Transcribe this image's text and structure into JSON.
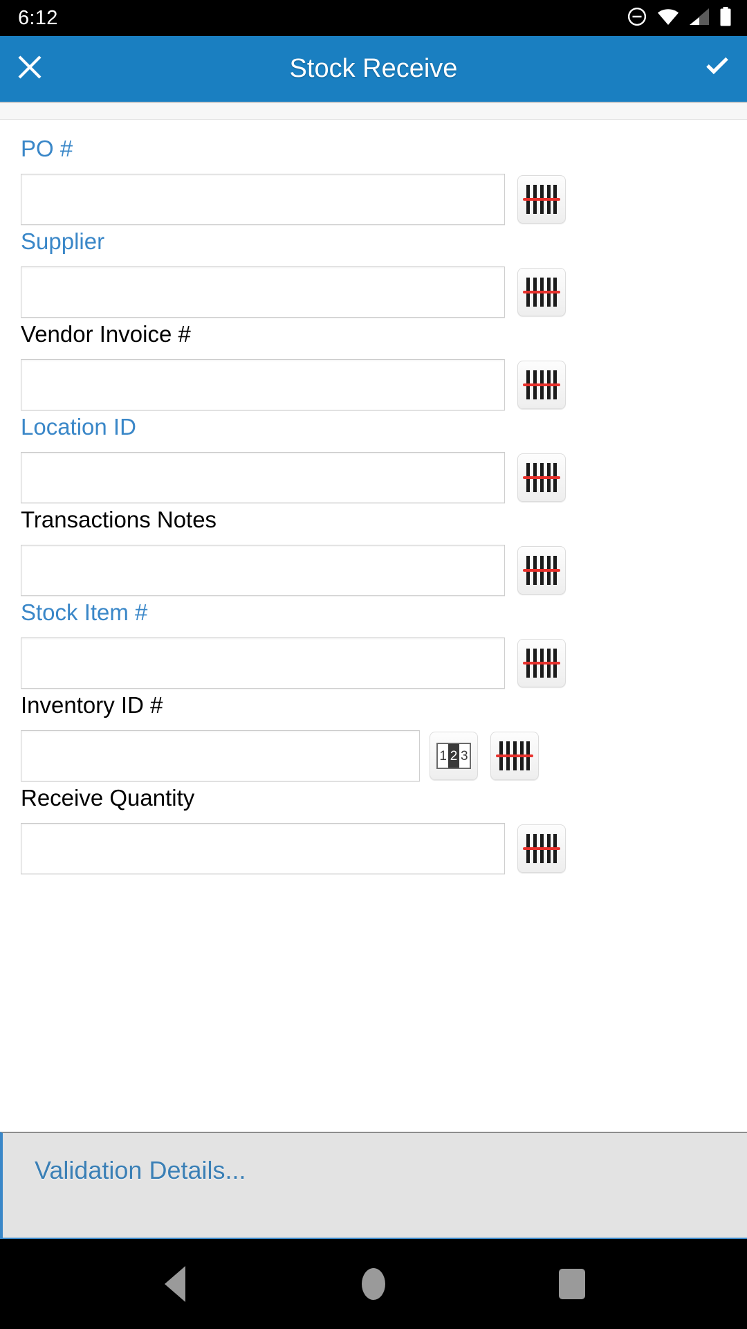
{
  "statusbar": {
    "time": "6:12",
    "icons": [
      {
        "name": "do-not-disturb-icon"
      },
      {
        "name": "wifi-icon"
      },
      {
        "name": "cellular-signal-icon"
      },
      {
        "name": "battery-icon"
      }
    ]
  },
  "appbar": {
    "title": "Stock Receive",
    "close_icon": "close-icon",
    "confirm_icon": "check-icon",
    "background_color": "#1a7fc1"
  },
  "theme": {
    "accent_blue": "#3a87c8",
    "label_black": "#000000",
    "barcode_laser_red": "#e8312c",
    "validation_background": "#e3e3e3"
  },
  "form": {
    "fields": [
      {
        "label": "PO #",
        "label_color": "blue",
        "value": "",
        "placeholder": "",
        "has_number_button": false
      },
      {
        "label": "Supplier",
        "label_color": "blue",
        "value": "",
        "placeholder": "",
        "has_number_button": false
      },
      {
        "label": "Vendor Invoice #",
        "label_color": "black",
        "value": "",
        "placeholder": "",
        "has_number_button": false
      },
      {
        "label": "Location ID",
        "label_color": "blue",
        "value": "",
        "placeholder": "",
        "has_number_button": false
      },
      {
        "label": "Transactions Notes",
        "label_color": "black",
        "value": "",
        "placeholder": "",
        "has_number_button": false
      },
      {
        "label": "Stock Item #",
        "label_color": "blue",
        "value": "",
        "placeholder": "",
        "has_number_button": false
      },
      {
        "label": "Inventory ID #",
        "label_color": "black",
        "value": "",
        "placeholder": "",
        "has_number_button": true
      },
      {
        "label": "Receive Quantity",
        "label_color": "black",
        "value": "",
        "placeholder": "",
        "has_number_button": false
      }
    ],
    "barcode_button_icon": "barcode-scan-icon",
    "number_button_icon": "number-counter-icon",
    "number_button_digits": [
      "1",
      "2",
      "3"
    ]
  },
  "validation": {
    "text": "Validation Details..."
  },
  "navbar": {
    "back_icon": "back-triangle-icon",
    "home_icon": "home-circle-icon",
    "recents_icon": "recents-square-icon"
  }
}
